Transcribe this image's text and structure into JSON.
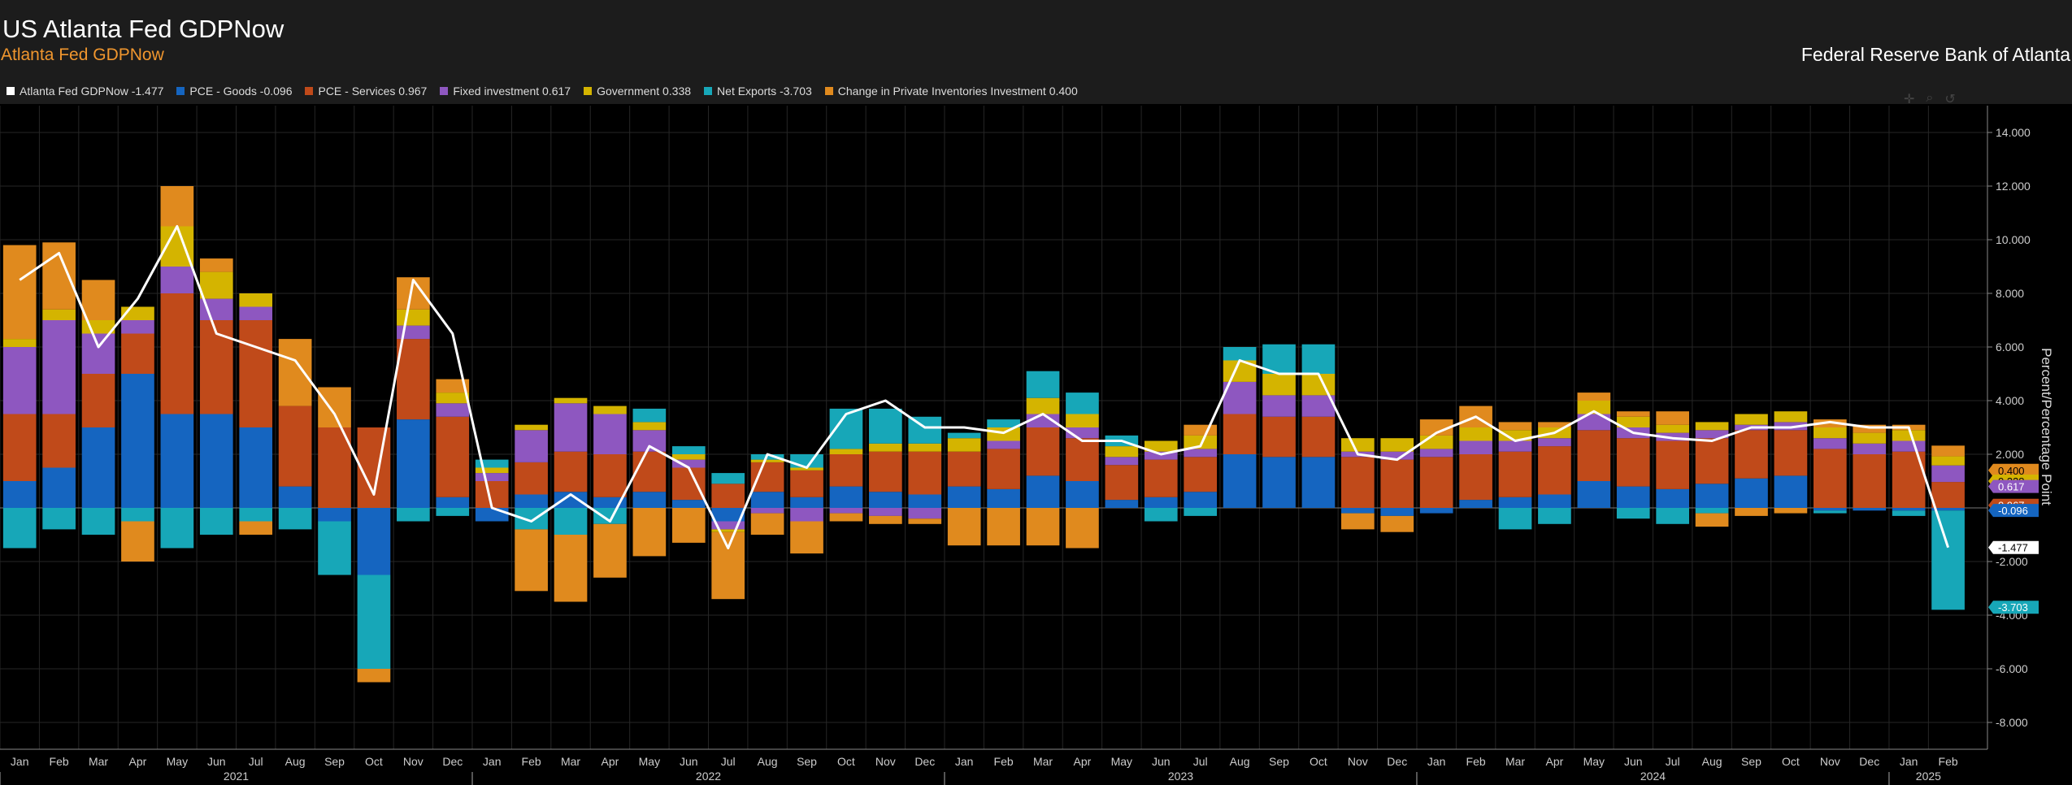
{
  "header": {
    "title": "US Atlanta Fed GDPNow",
    "subtitle": "Atlanta Fed GDPNow",
    "source": "Federal Reserve Bank of Atlanta"
  },
  "legend": [
    {
      "label": "Atlanta Fed GDPNow -1.477",
      "color": "#ffffff"
    },
    {
      "label": "PCE - Goods -0.096",
      "color": "#1565c0"
    },
    {
      "label": "PCE - Services 0.967",
      "color": "#c04a1a"
    },
    {
      "label": "Fixed investment 0.617",
      "color": "#8e57c0"
    },
    {
      "label": "Government 0.338",
      "color": "#d4b400"
    },
    {
      "label": "Net Exports -3.703",
      "color": "#17a7b8"
    },
    {
      "label": "Change in Private Inventories Investment 0.400",
      "color": "#e08a1e"
    }
  ],
  "toolbar": {
    "crosshair_icon": "✛",
    "zoom_icon": "⌕",
    "reset_icon": "↺"
  },
  "chart_data": {
    "type": "bar",
    "stacked": true,
    "ylabel": "Percent/Percentage Point",
    "ylim": [
      -9,
      15
    ],
    "y_ticks": [
      "14.000",
      "12.000",
      "10.000",
      "8.000",
      "6.000",
      "4.000",
      "2.000",
      "-2.000",
      "-4.000",
      "-6.000",
      "-8.000"
    ],
    "grid": true,
    "month_labels": [
      "Jan",
      "Feb",
      "Mar",
      "Apr",
      "May",
      "Jun",
      "Jul",
      "Aug",
      "Sep",
      "Oct",
      "Nov",
      "Dec",
      "Jan",
      "Feb",
      "Mar",
      "Apr",
      "May",
      "Jun",
      "Jul",
      "Aug",
      "Sep",
      "Oct",
      "Nov",
      "Dec",
      "Jan",
      "Feb",
      "Mar",
      "Apr",
      "May",
      "Jun",
      "Jul",
      "Aug",
      "Sep",
      "Oct",
      "Nov",
      "Dec",
      "Jan",
      "Feb",
      "Mar",
      "Apr",
      "May",
      "Jun",
      "Jul",
      "Aug",
      "Sep",
      "Oct",
      "Nov",
      "Dec",
      "Jan",
      "Feb"
    ],
    "year_labels": [
      "2021",
      "2022",
      "2023",
      "2024",
      "2025"
    ],
    "x_months": [
      "2021-01",
      "2021-02",
      "2021-03",
      "2021-04",
      "2021-05",
      "2021-06",
      "2021-07",
      "2021-08",
      "2021-09",
      "2021-10",
      "2021-11",
      "2021-12",
      "2022-01",
      "2022-02",
      "2022-03",
      "2022-04",
      "2022-05",
      "2022-06",
      "2022-07",
      "2022-08",
      "2022-09",
      "2022-10",
      "2022-11",
      "2022-12",
      "2023-01",
      "2023-02",
      "2023-03",
      "2023-04",
      "2023-05",
      "2023-06",
      "2023-07",
      "2023-08",
      "2023-09",
      "2023-10",
      "2023-11",
      "2023-12",
      "2024-01",
      "2024-02",
      "2024-03",
      "2024-04",
      "2024-05",
      "2024-06",
      "2024-07",
      "2024-08",
      "2024-09",
      "2024-10",
      "2024-11",
      "2024-12",
      "2025-01",
      "2025-02"
    ],
    "series": [
      {
        "name": "PCE - Goods",
        "color": "#1565c0",
        "values": [
          1.0,
          1.5,
          3.0,
          5.0,
          3.5,
          3.5,
          3.0,
          0.8,
          -0.5,
          -2.5,
          3.3,
          0.4,
          -0.5,
          0.5,
          0.6,
          0.4,
          0.6,
          0.3,
          -0.5,
          0.6,
          0.4,
          0.8,
          0.6,
          0.5,
          0.8,
          0.7,
          1.2,
          1.0,
          0.3,
          0.4,
          0.6,
          2.0,
          1.9,
          1.9,
          -0.2,
          -0.3,
          -0.2,
          0.3,
          0.4,
          0.5,
          1.0,
          0.8,
          0.7,
          0.9,
          1.1,
          1.2,
          -0.1,
          -0.1,
          -0.1,
          -0.096
        ]
      },
      {
        "name": "PCE - Services",
        "color": "#c04a1a",
        "values": [
          2.5,
          2.0,
          2.0,
          1.5,
          4.5,
          3.5,
          4.0,
          3.0,
          3.0,
          3.0,
          3.0,
          3.0,
          1.0,
          1.2,
          1.5,
          1.6,
          1.5,
          1.2,
          0.9,
          1.1,
          1.0,
          1.2,
          1.5,
          1.6,
          1.3,
          1.5,
          1.8,
          1.6,
          1.3,
          1.4,
          1.3,
          1.5,
          1.5,
          1.5,
          1.9,
          1.8,
          1.9,
          1.7,
          1.7,
          1.8,
          1.9,
          1.8,
          1.8,
          1.7,
          1.8,
          1.7,
          2.2,
          2.0,
          2.1,
          0.967
        ]
      },
      {
        "name": "Fixed investment",
        "color": "#8e57c0",
        "values": [
          2.5,
          3.5,
          1.5,
          0.5,
          1.0,
          0.8,
          0.5,
          0.0,
          0.0,
          0.0,
          0.5,
          0.5,
          0.3,
          1.2,
          1.8,
          1.5,
          0.8,
          0.3,
          -0.3,
          -0.2,
          -0.5,
          -0.2,
          -0.3,
          -0.4,
          0.0,
          0.3,
          0.5,
          0.4,
          0.3,
          0.3,
          0.3,
          1.2,
          0.8,
          0.8,
          0.2,
          0.3,
          0.3,
          0.5,
          0.4,
          0.3,
          0.6,
          0.4,
          0.3,
          0.3,
          0.2,
          0.3,
          0.4,
          0.4,
          0.4,
          0.617
        ]
      },
      {
        "name": "Government",
        "color": "#d4b400",
        "values": [
          0.3,
          0.4,
          0.5,
          0.5,
          1.5,
          1.0,
          0.5,
          0.0,
          0.0,
          0.0,
          0.6,
          0.4,
          0.2,
          0.2,
          0.2,
          0.3,
          0.3,
          0.2,
          -0.1,
          0.1,
          0.1,
          0.2,
          0.3,
          0.3,
          0.5,
          0.5,
          0.6,
          0.5,
          0.4,
          0.4,
          0.5,
          0.8,
          0.8,
          0.8,
          0.5,
          0.5,
          0.5,
          0.5,
          0.4,
          0.4,
          0.5,
          0.4,
          0.3,
          0.3,
          0.4,
          0.4,
          0.4,
          0.4,
          0.4,
          0.338
        ]
      },
      {
        "name": "Net Exports",
        "color": "#17a7b8",
        "values": [
          -1.5,
          -0.8,
          -1.0,
          -0.5,
          -1.5,
          -1.0,
          -0.5,
          -0.8,
          -2.0,
          -3.5,
          -0.5,
          -0.3,
          0.3,
          -0.8,
          -1.0,
          -0.6,
          0.5,
          0.3,
          0.4,
          0.2,
          0.5,
          1.5,
          1.3,
          1.0,
          0.2,
          0.3,
          1.0,
          0.8,
          0.4,
          -0.5,
          -0.3,
          0.5,
          1.1,
          1.1,
          0.0,
          0.0,
          0.0,
          0.0,
          -0.8,
          -0.6,
          0.0,
          -0.4,
          -0.6,
          -0.2,
          0.0,
          0.0,
          -0.1,
          0.0,
          -0.2,
          -3.703
        ]
      },
      {
        "name": "Change in Private Inventories Investment",
        "color": "#e08a1e",
        "values": [
          3.5,
          2.5,
          1.5,
          -1.5,
          1.5,
          0.5,
          -0.5,
          2.5,
          1.5,
          -0.5,
          1.2,
          0.5,
          0.0,
          -2.3,
          -2.5,
          -2.0,
          -1.8,
          -1.3,
          -2.5,
          -0.8,
          -1.2,
          -0.3,
          -0.3,
          -0.2,
          -1.4,
          -1.4,
          -1.4,
          -1.5,
          0.0,
          0.0,
          0.4,
          0.0,
          0.0,
          0.0,
          -0.6,
          -0.6,
          0.6,
          0.8,
          0.3,
          0.2,
          0.3,
          0.2,
          0.5,
          -0.5,
          -0.3,
          -0.2,
          0.3,
          0.3,
          0.2,
          0.4
        ]
      }
    ],
    "line": {
      "name": "Atlanta Fed GDPNow",
      "color": "#ffffff",
      "values": [
        8.5,
        9.5,
        6.0,
        7.8,
        10.5,
        6.5,
        6.0,
        5.5,
        3.5,
        0.5,
        8.5,
        6.5,
        0.0,
        -0.5,
        0.5,
        -0.5,
        2.3,
        1.5,
        -1.5,
        2.0,
        1.5,
        3.5,
        4.0,
        3.0,
        3.0,
        2.8,
        3.5,
        2.5,
        2.5,
        2.0,
        2.3,
        5.5,
        5.0,
        5.0,
        2.0,
        1.8,
        2.8,
        3.4,
        2.5,
        2.8,
        3.6,
        2.8,
        2.6,
        2.5,
        3.0,
        3.0,
        3.2,
        3.0,
        3.0,
        -1.477
      ]
    },
    "last_value_flags": [
      {
        "label": "0.400",
        "value": 1.4,
        "color": "#e08a1e"
      },
      {
        "label": "0.338",
        "value": 1.0,
        "color": "#d4b400"
      },
      {
        "label": "0.617",
        "value": 0.8,
        "color": "#8e57c0"
      },
      {
        "label": "0.967",
        "value": 0.1,
        "color": "#c04a1a"
      },
      {
        "label": "-0.096",
        "value": -0.096,
        "color": "#1565c0"
      },
      {
        "label": "-1.477",
        "value": -1.477,
        "color": "#ffffff"
      },
      {
        "label": "-3.703",
        "value": -3.703,
        "color": "#17a7b8"
      }
    ]
  }
}
